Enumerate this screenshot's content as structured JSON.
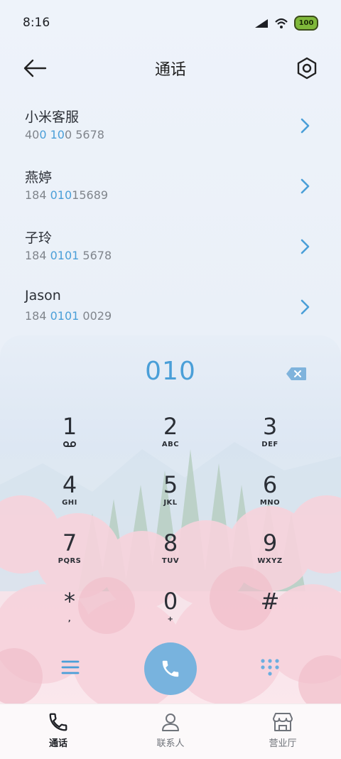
{
  "status_bar": {
    "time": "8:16",
    "battery": "100"
  },
  "header": {
    "title": "通话"
  },
  "calls": [
    {
      "name": "小米客服",
      "num_parts": [
        "40",
        "0 10",
        "0 5678"
      ]
    },
    {
      "name": "燕婷",
      "num_parts": [
        "184 ",
        "010",
        "15689"
      ]
    },
    {
      "name": "子玲",
      "num_parts": [
        "184 ",
        "0101",
        " 5678"
      ]
    },
    {
      "name": "Jason",
      "num_parts": [
        "184 ",
        "0101",
        " 0029"
      ]
    }
  ],
  "dialer": {
    "input": "010",
    "keys": [
      {
        "digit": "1",
        "letters": ""
      },
      {
        "digit": "2",
        "letters": "ABC"
      },
      {
        "digit": "3",
        "letters": "DEF"
      },
      {
        "digit": "4",
        "letters": "GHI"
      },
      {
        "digit": "5",
        "letters": "JKL"
      },
      {
        "digit": "6",
        "letters": "MNO"
      },
      {
        "digit": "7",
        "letters": "PQRS"
      },
      {
        "digit": "8",
        "letters": "TUV"
      },
      {
        "digit": "9",
        "letters": "WXYZ"
      },
      {
        "digit": "*",
        "letters": ","
      },
      {
        "digit": "0",
        "letters": "+"
      },
      {
        "digit": "#",
        "letters": ""
      }
    ]
  },
  "nav": {
    "calls": "通话",
    "contacts": "联系人",
    "store": "营业厅"
  },
  "colors": {
    "accent": "#4a9fd8",
    "call_button": "#78b3de"
  }
}
